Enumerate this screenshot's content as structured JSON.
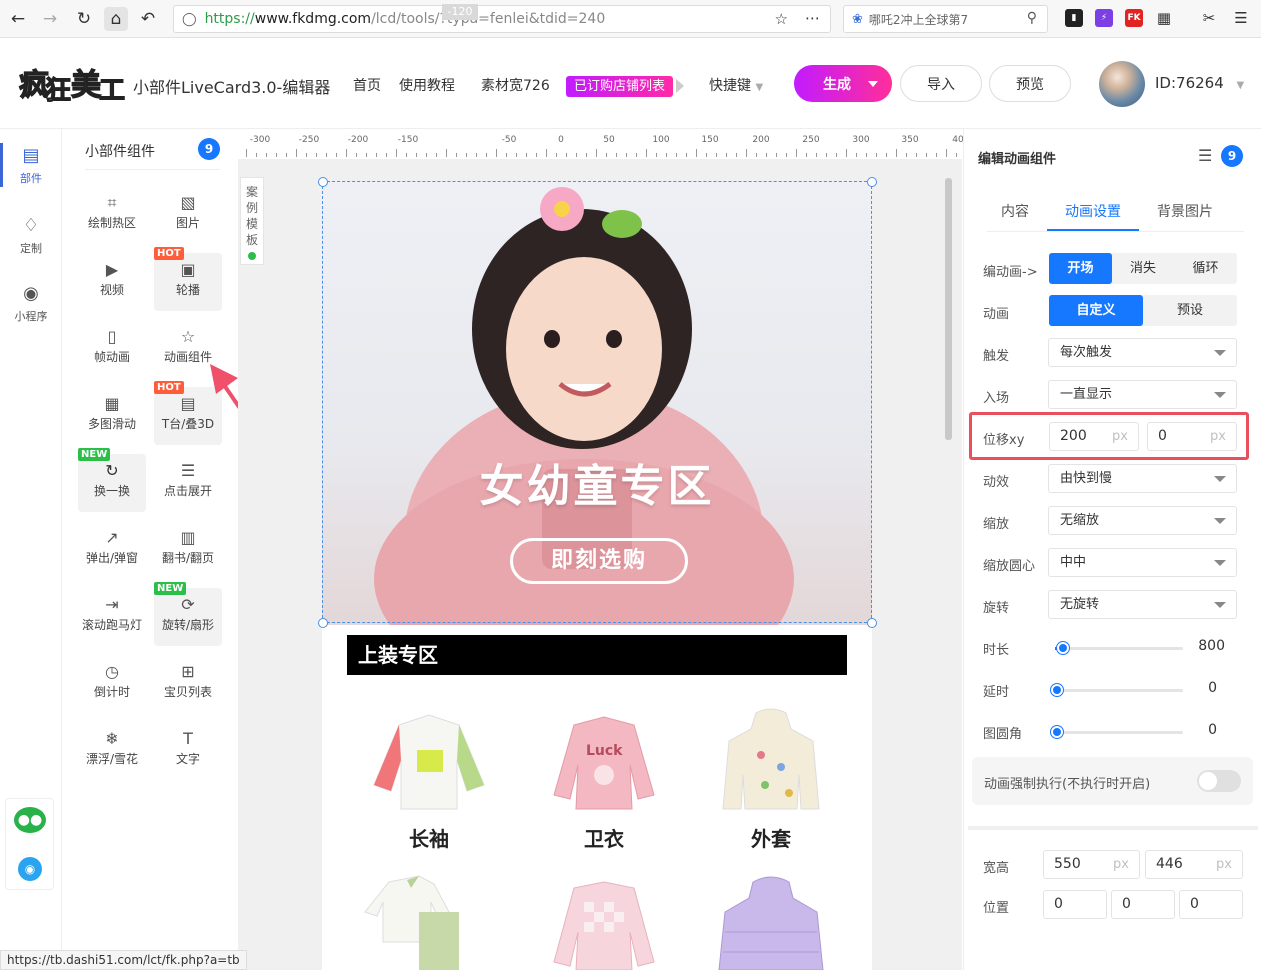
{
  "browser": {
    "url_scheme": "https://",
    "url_host": "www.fkdmg.com",
    "url_rest": "/lcd/tools/?typa=fenlei&tdid=240",
    "search_text": "哪吒2冲上全球第7",
    "ext_fk": "FK"
  },
  "header": {
    "logo_text": "疯狂美工",
    "title": "小部件LiveCard3.0-编辑器",
    "nav": [
      "首页",
      "使用教程",
      "素材宽726"
    ],
    "chip": "已订购店铺列表",
    "shortcut": "快捷键",
    "generate": "生成",
    "import": "导入",
    "preview": "预览",
    "user_id": "ID:76264"
  },
  "rail": {
    "items": [
      {
        "label": "部件"
      },
      {
        "label": "定制"
      },
      {
        "label": "小程序"
      }
    ]
  },
  "widgets": {
    "title": "小部件组件",
    "count": "9",
    "hot": "HOT",
    "new": "NEW",
    "items": [
      {
        "label": "绘制热区",
        "icon": "hotspot-icon"
      },
      {
        "label": "图片",
        "icon": "image-icon"
      },
      {
        "label": "视频",
        "icon": "video-icon"
      },
      {
        "label": "轮播",
        "icon": "carousel-icon"
      },
      {
        "label": "帧动画",
        "icon": "gif-icon"
      },
      {
        "label": "动画组件",
        "icon": "star-icon"
      },
      {
        "label": "多图滑动",
        "icon": "slides-icon"
      },
      {
        "label": "T台/叠3D",
        "icon": "stack3d-icon"
      },
      {
        "label": "换一换",
        "icon": "refresh-icon"
      },
      {
        "label": "点击展开",
        "icon": "expand-icon"
      },
      {
        "label": "弹出/弹窗",
        "icon": "popup-icon"
      },
      {
        "label": "翻书/翻页",
        "icon": "book-icon"
      },
      {
        "label": "滚动跑马灯",
        "icon": "marquee-icon"
      },
      {
        "label": "旋转/扇形",
        "icon": "rotate-icon"
      },
      {
        "label": "倒计时",
        "icon": "clock-icon"
      },
      {
        "label": "宝贝列表",
        "icon": "grid-icon"
      },
      {
        "label": "漂浮/雪花",
        "icon": "snowflake-icon"
      },
      {
        "label": "文字",
        "icon": "text-icon"
      }
    ]
  },
  "ruler": {
    "labels": [
      "-300",
      "-250",
      "-200",
      "-150",
      "-120",
      "-50",
      "0",
      "50",
      "100",
      "150",
      "200",
      "250",
      "300",
      "350",
      "40"
    ]
  },
  "case_tab": "案例模板",
  "canvas": {
    "banner_title": "女幼童专区",
    "banner_button": "即刻选购",
    "section_title": "上装专区",
    "products": [
      "长袖",
      "卫衣",
      "外套"
    ]
  },
  "panel": {
    "title": "编辑动画组件",
    "count": "9",
    "tabs": [
      "内容",
      "动画设置",
      "背景图片"
    ],
    "edit_anim_label": "编动画->",
    "edit_anim_options": [
      "开场",
      "消失",
      "循环"
    ],
    "anim_label": "动画",
    "anim_options": [
      "自定义",
      "预设"
    ],
    "trigger_label": "触发",
    "trigger_value": "每次触发",
    "enter_label": "入场",
    "enter_value": "一直显示",
    "offset_label": "位移xy",
    "offset_x": "200",
    "offset_y": "0",
    "unit": "px",
    "effect_label": "动效",
    "effect_value": "由快到慢",
    "scale_label": "缩放",
    "scale_value": "无缩放",
    "scale_origin_label": "缩放圆心",
    "scale_origin_value": "中中",
    "rotate_label": "旋转",
    "rotate_value": "无旋转",
    "duration_label": "时长",
    "duration_value": "800",
    "duration_fraction": 0.05,
    "delay_label": "延时",
    "delay_value": "0",
    "radius_label": "图圆角",
    "radius_value": "0",
    "force_label": "动画强制执行(不执行时开启)",
    "size_label": "宽高",
    "width": "550",
    "height": "446",
    "pos_label": "位置",
    "pos_values": [
      "0",
      "0",
      "0"
    ]
  },
  "status_url": "https://tb.dashi51.com/lct/fk.php?a=tb",
  "colors": {
    "accent": "#1677ff",
    "brand_gradient_start": "#c21bff",
    "brand_gradient_end": "#ff2e9a",
    "highlight": "#e8505b"
  }
}
